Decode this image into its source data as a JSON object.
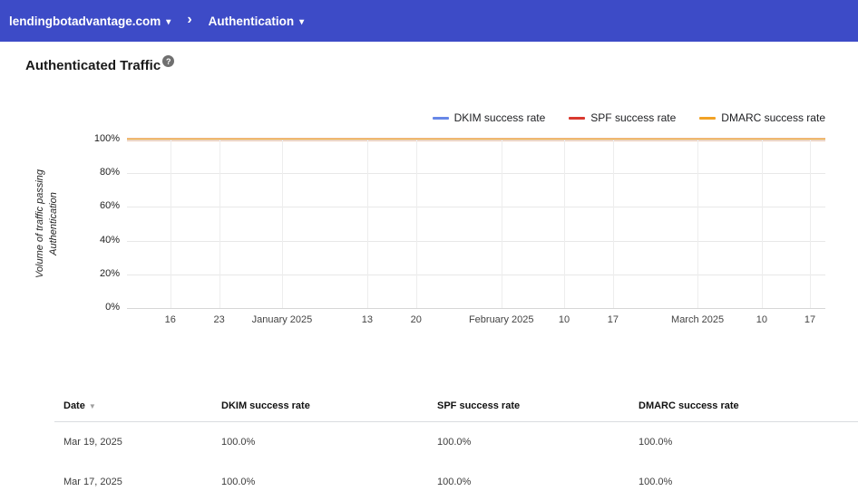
{
  "topbar": {
    "domain": "lendingbotadvantage.com",
    "domain_caret": "▾",
    "chevron": "›",
    "section": "Authentication",
    "section_caret": "▾"
  },
  "page": {
    "title": "Authenticated Traffic",
    "help": "?"
  },
  "chart_data": {
    "type": "line",
    "title": "Authenticated Traffic",
    "ylabel": "Volume of traffic passing Authentication",
    "ylim": [
      0,
      100
    ],
    "grid": true,
    "legend_position": "top-right",
    "y_tick_labels": [
      "100%",
      "80%",
      "60%",
      "40%",
      "20%",
      "0%"
    ],
    "x_tick_labels": [
      "16",
      "23",
      "January 2025",
      "13",
      "20",
      "February 2025",
      "10",
      "17",
      "March 2025",
      "10",
      "17"
    ],
    "x_tick_fractions": [
      0.062,
      0.132,
      0.222,
      0.344,
      0.414,
      0.536,
      0.626,
      0.696,
      0.817,
      0.909,
      0.978
    ],
    "series": [
      {
        "name": "DKIM success rate",
        "color": "#6787e7",
        "values": [
          100,
          100,
          100,
          100,
          100,
          100,
          100,
          100,
          100,
          100,
          100
        ]
      },
      {
        "name": "SPF success rate",
        "color": "#d9392f",
        "values": [
          100,
          100,
          100,
          100,
          100,
          100,
          100,
          100,
          100,
          100,
          100
        ]
      },
      {
        "name": "DMARC success rate",
        "color": "#f1a225",
        "values": [
          100,
          100,
          100,
          100,
          100,
          100,
          100,
          100,
          100,
          100,
          100
        ]
      }
    ]
  },
  "table": {
    "headers": [
      "Date",
      "DKIM success rate",
      "SPF success rate",
      "DMARC success rate"
    ],
    "sort_icon": "▼",
    "rows": [
      [
        "Mar 19, 2025",
        "100.0%",
        "100.0%",
        "100.0%"
      ],
      [
        "Mar 17, 2025",
        "100.0%",
        "100.0%",
        "100.0%"
      ]
    ]
  },
  "colors": {
    "topbar": "#3d4bc7",
    "dkim": "#6787e7",
    "spf": "#d9392f",
    "dmarc": "#f1a225"
  }
}
